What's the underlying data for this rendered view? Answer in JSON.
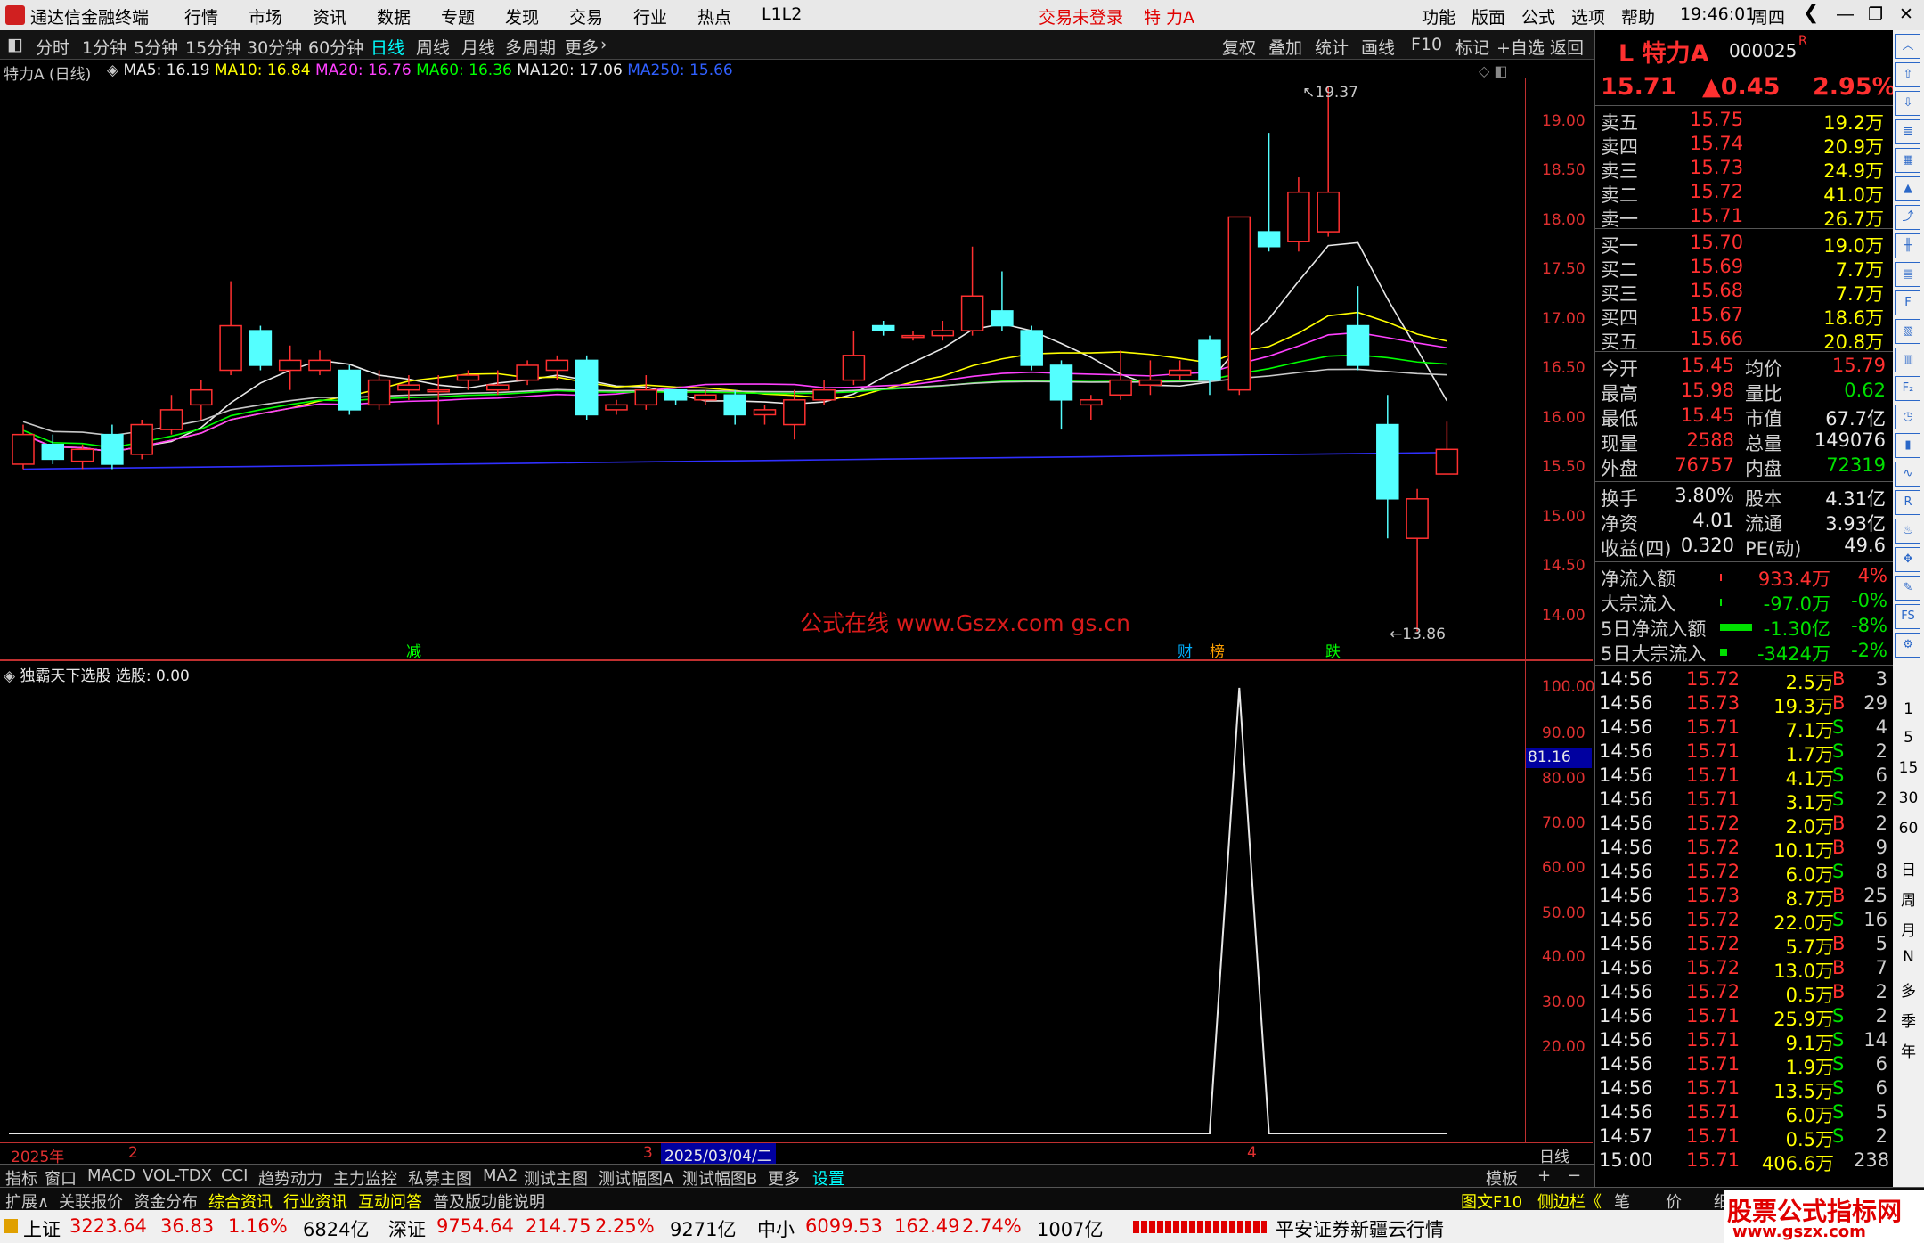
{
  "app": {
    "title": "通达信金融终端",
    "menu": [
      "行情",
      "市场",
      "资讯",
      "数据",
      "专题",
      "发现",
      "交易",
      "行业",
      "热点",
      "L1L2"
    ],
    "login_status": "交易未登录",
    "stock_short": "特 力A",
    "right_menu": [
      "功能",
      "版面",
      "公式",
      "选项",
      "帮助"
    ],
    "time": "19:46:01",
    "weekday": "周四"
  },
  "period_tabs": [
    "分时",
    "1分钟",
    "5分钟",
    "15分钟",
    "30分钟",
    "60分钟",
    "日线",
    "周线",
    "月线",
    "多周期",
    "更多"
  ],
  "active_period": "日线",
  "tool_buttons": [
    "复权",
    "叠加",
    "统计",
    "画线",
    "F10",
    "标记",
    "+自选",
    "返回"
  ],
  "main_chart": {
    "title": "特力A (日线)",
    "ma": [
      {
        "label": "MA5: 16.19",
        "color": "#e8e8e8"
      },
      {
        "label": "MA10: 16.84",
        "color": "#ffff00"
      },
      {
        "label": "MA20: 16.76",
        "color": "#ff40ff"
      },
      {
        "label": "MA60: 16.36",
        "color": "#00ff00"
      },
      {
        "label": "MA120: 17.06",
        "color": "#e8e8e8"
      },
      {
        "label": "MA250: 15.66",
        "color": "#3060ff"
      }
    ],
    "high_marker": "19.37",
    "low_marker": "13.86",
    "event_markers": [
      "减",
      "财",
      "榜",
      "跌"
    ],
    "watermark": "公式在线 www.Gszx.com  gs.cn",
    "yaxis": [
      "19.00",
      "18.50",
      "18.00",
      "17.50",
      "17.00",
      "16.50",
      "16.00",
      "15.50",
      "15.00",
      "14.50",
      "14.00"
    ]
  },
  "chart_data": {
    "type": "candlestick",
    "ylim": [
      13.8,
      19.5
    ],
    "candles": [
      [
        15.55,
        15.85,
        15.95,
        15.5
      ],
      [
        15.75,
        15.6,
        15.85,
        15.55
      ],
      [
        15.58,
        15.7,
        15.75,
        15.5
      ],
      [
        15.85,
        15.55,
        15.95,
        15.5
      ],
      [
        15.65,
        15.95,
        16.0,
        15.6
      ],
      [
        15.9,
        16.1,
        16.25,
        15.85
      ],
      [
        16.15,
        16.3,
        16.4,
        16.0
      ],
      [
        16.5,
        16.95,
        17.4,
        16.45
      ],
      [
        16.9,
        16.55,
        16.95,
        16.5
      ],
      [
        16.5,
        16.6,
        16.75,
        16.3
      ],
      [
        16.5,
        16.6,
        16.7,
        16.45
      ],
      [
        16.5,
        16.1,
        16.55,
        16.05
      ],
      [
        16.15,
        16.4,
        16.5,
        16.1
      ],
      [
        16.3,
        16.35,
        16.45,
        16.2
      ],
      [
        16.3,
        16.3,
        16.45,
        15.95
      ],
      [
        16.4,
        16.45,
        16.5,
        16.3
      ],
      [
        16.3,
        16.35,
        16.5,
        16.25
      ],
      [
        16.4,
        16.55,
        16.6,
        16.35
      ],
      [
        16.5,
        16.6,
        16.65,
        16.4
      ],
      [
        16.6,
        16.05,
        16.65,
        16.0
      ],
      [
        16.1,
        16.15,
        16.2,
        16.05
      ],
      [
        16.15,
        16.3,
        16.45,
        16.1
      ],
      [
        16.3,
        16.2,
        16.3,
        16.15
      ],
      [
        16.2,
        16.25,
        16.3,
        16.15
      ],
      [
        16.25,
        16.05,
        16.3,
        15.95
      ],
      [
        16.05,
        16.1,
        16.15,
        15.95
      ],
      [
        15.95,
        16.2,
        16.3,
        15.8
      ],
      [
        16.2,
        16.3,
        16.4,
        16.15
      ],
      [
        16.4,
        16.65,
        16.9,
        16.35
      ],
      [
        16.95,
        16.9,
        17.0,
        16.85
      ],
      [
        16.85,
        16.85,
        16.9,
        16.8
      ],
      [
        16.85,
        16.9,
        17.0,
        16.8
      ],
      [
        16.9,
        17.25,
        17.75,
        16.85
      ],
      [
        17.1,
        16.95,
        17.5,
        16.9
      ],
      [
        16.9,
        16.55,
        16.95,
        16.5
      ],
      [
        16.55,
        16.2,
        16.6,
        15.9
      ],
      [
        16.15,
        16.2,
        16.25,
        16.0
      ],
      [
        16.25,
        16.4,
        16.7,
        16.2
      ],
      [
        16.35,
        16.4,
        16.6,
        16.25
      ],
      [
        16.45,
        16.5,
        16.6,
        16.4
      ],
      [
        16.8,
        16.4,
        16.85,
        16.25
      ],
      [
        16.3,
        18.05,
        18.05,
        16.25
      ],
      [
        17.9,
        17.75,
        18.9,
        17.7
      ],
      [
        17.8,
        18.3,
        18.45,
        17.7
      ],
      [
        17.9,
        18.3,
        19.37,
        17.85
      ],
      [
        16.95,
        16.55,
        17.35,
        16.5
      ],
      [
        15.95,
        15.2,
        16.25,
        14.8
      ],
      [
        14.8,
        15.2,
        15.3,
        13.86
      ],
      [
        15.45,
        15.7,
        15.98,
        15.45
      ]
    ],
    "indicator": {
      "title": "独霸天下选股",
      "value_label": "选股: 0.00",
      "current": "81.16",
      "yaxis": [
        "100.00",
        "90.00",
        "80.00",
        "70.00",
        "60.00",
        "50.00",
        "40.00",
        "30.00",
        "20.00"
      ],
      "series": [
        0,
        0,
        0,
        0,
        0,
        0,
        0,
        0,
        0,
        0,
        0,
        0,
        0,
        0,
        0,
        0,
        0,
        0,
        0,
        0,
        0,
        0,
        0,
        0,
        0,
        0,
        0,
        0,
        0,
        0,
        0,
        0,
        0,
        0,
        0,
        0,
        0,
        0,
        0,
        0,
        0,
        100,
        0,
        0,
        0,
        0,
        0,
        0,
        0
      ]
    },
    "xaxis": [
      "2025年",
      "2",
      "3",
      "2025/03/04/二",
      "4"
    ],
    "xaxis_right": "日线"
  },
  "quote": {
    "name": "特力A",
    "code": "000025",
    "flag": "R",
    "price": "15.71",
    "change": "▲0.45",
    "pct": "2.95%",
    "asks": [
      {
        "label": "卖五",
        "price": "15.75",
        "vol": "19.2万"
      },
      {
        "label": "卖四",
        "price": "15.74",
        "vol": "20.9万"
      },
      {
        "label": "卖三",
        "price": "15.73",
        "vol": "24.9万"
      },
      {
        "label": "卖二",
        "price": "15.72",
        "vol": "41.0万"
      },
      {
        "label": "卖一",
        "price": "15.71",
        "vol": "26.7万"
      }
    ],
    "bids": [
      {
        "label": "买一",
        "price": "15.70",
        "vol": "19.0万"
      },
      {
        "label": "买二",
        "price": "15.69",
        "vol": "7.7万"
      },
      {
        "label": "买三",
        "price": "15.68",
        "vol": "7.7万"
      },
      {
        "label": "买四",
        "price": "15.67",
        "vol": "18.6万"
      },
      {
        "label": "买五",
        "price": "15.66",
        "vol": "20.8万"
      }
    ],
    "stats": [
      {
        "l1": "今开",
        "v1": "15.45",
        "l2": "均价",
        "v2": "15.79"
      },
      {
        "l1": "最高",
        "v1": "15.98",
        "l2": "量比",
        "v2": "0.62"
      },
      {
        "l1": "最低",
        "v1": "15.45",
        "l2": "市值",
        "v2": "67.7亿"
      },
      {
        "l1": "现量",
        "v1": "2588",
        "l2": "总量",
        "v2": "149076"
      },
      {
        "l1": "外盘",
        "v1": "76757",
        "l2": "内盘",
        "v2": "72319"
      }
    ],
    "stats2": [
      {
        "l1": "换手",
        "v1": "3.80%",
        "l2": "股本",
        "v2": "4.31亿"
      },
      {
        "l1": "净资",
        "v1": "4.01",
        "l2": "流通",
        "v2": "3.93亿"
      },
      {
        "l1": "收益(四)",
        "v1": "0.320",
        "l2": "PE(动)",
        "v2": "49.6"
      }
    ],
    "flows": [
      {
        "label": "净流入额",
        "value": "933.4万",
        "pct": "4%"
      },
      {
        "label": "大宗流入",
        "value": "-97.0万",
        "pct": "-0%"
      },
      {
        "label": "5日净流入额",
        "value": "-1.30亿",
        "pct": "-8%"
      },
      {
        "label": "5日大宗流入",
        "value": "-3424万",
        "pct": "-2%"
      }
    ],
    "ticks": [
      [
        "14:56",
        "15.72",
        "2.5万",
        "B",
        "3"
      ],
      [
        "14:56",
        "15.73",
        "19.3万",
        "B",
        "29"
      ],
      [
        "14:56",
        "15.71",
        "7.1万",
        "S",
        "4"
      ],
      [
        "14:56",
        "15.71",
        "1.7万",
        "S",
        "2"
      ],
      [
        "14:56",
        "15.71",
        "4.1万",
        "S",
        "6"
      ],
      [
        "14:56",
        "15.71",
        "3.1万",
        "S",
        "2"
      ],
      [
        "14:56",
        "15.72",
        "2.0万",
        "B",
        "2"
      ],
      [
        "14:56",
        "15.72",
        "10.1万",
        "B",
        "9"
      ],
      [
        "14:56",
        "15.72",
        "6.0万",
        "S",
        "8"
      ],
      [
        "14:56",
        "15.73",
        "8.7万",
        "B",
        "25"
      ],
      [
        "14:56",
        "15.72",
        "22.0万",
        "S",
        "16"
      ],
      [
        "14:56",
        "15.72",
        "5.7万",
        "B",
        "5"
      ],
      [
        "14:56",
        "15.72",
        "13.0万",
        "B",
        "7"
      ],
      [
        "14:56",
        "15.72",
        "0.5万",
        "B",
        "2"
      ],
      [
        "14:56",
        "15.71",
        "25.9万",
        "S",
        "2"
      ],
      [
        "14:56",
        "15.71",
        "9.1万",
        "S",
        "14"
      ],
      [
        "14:56",
        "15.71",
        "1.9万",
        "S",
        "6"
      ],
      [
        "14:56",
        "15.71",
        "13.5万",
        "S",
        "6"
      ],
      [
        "14:56",
        "15.71",
        "6.0万",
        "S",
        "5"
      ],
      [
        "14:57",
        "15.71",
        "0.5万",
        "S",
        "2"
      ],
      [
        "15:00",
        "15.71",
        "406.6万",
        "",
        "238"
      ]
    ]
  },
  "bottom_tabs": [
    "指标",
    "窗口",
    "MACD",
    "VOL-TDX",
    "CCI",
    "趋势动力",
    "主力监控",
    "私募主图",
    "MA2",
    "测试主图",
    "测试幅图A",
    "测试幅图B",
    "更多",
    "设置"
  ],
  "bottom_right": [
    "模板",
    "+",
    "−"
  ],
  "bottom_tabs2": [
    "扩展∧",
    "关联报价",
    "资金分布",
    "综合资讯",
    "行业资讯",
    "互动问答",
    "普及版功能说明"
  ],
  "bottom_tabs2_right": [
    "图文F10",
    "侧边栏《",
    "笔",
    "价",
    "细"
  ],
  "status": {
    "sh": {
      "name": "上证",
      "value": "3223.64",
      "chg": "36.83",
      "pct": "1.16%",
      "amt": "6824亿"
    },
    "sz": {
      "name": "深证",
      "value": "9754.64",
      "chg": "214.75",
      "pct": "2.25%",
      "amt": "9271亿"
    },
    "zx": {
      "name": "中小",
      "value": "6099.53",
      "chg": "162.49",
      "pct": "2.74%",
      "amt": "1007亿"
    },
    "broker": "平安证券新疆云行情",
    "brand": "股票公式指标网",
    "brand_url": "www.gszx.com"
  },
  "right_strip": [
    "1",
    "5",
    "15",
    "30",
    "60",
    "日",
    "周",
    "月",
    "N",
    "多",
    "季",
    "年"
  ]
}
